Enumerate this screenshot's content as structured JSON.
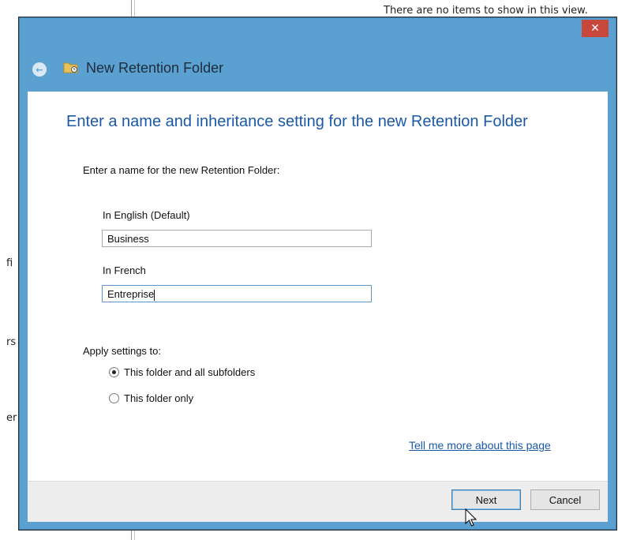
{
  "background": {
    "top_text": "There are no items to show in this view.",
    "fragments": [
      "fi",
      "rs",
      "er"
    ]
  },
  "dialog": {
    "title": "New Retention Folder",
    "close_label": "✕",
    "back_label": "←",
    "heading": "Enter a name and inheritance setting for the new Retention Folder",
    "name_prompt": "Enter a name for the new Retention Folder:",
    "english_label": "In English (Default)",
    "english_value": "Business",
    "french_label": "In French",
    "french_value": "Entreprise",
    "apply_label": "Apply settings to:",
    "options": [
      {
        "label": "This folder and all subfolders",
        "selected": true
      },
      {
        "label": "This folder only",
        "selected": false
      }
    ],
    "help_link": "Tell me more about this page",
    "next_label": "Next",
    "cancel_label": "Cancel"
  },
  "colors": {
    "titlebar": "#5aa1d1",
    "close": "#c8473c",
    "heading": "#1b58a8",
    "link": "#1b58a8"
  }
}
